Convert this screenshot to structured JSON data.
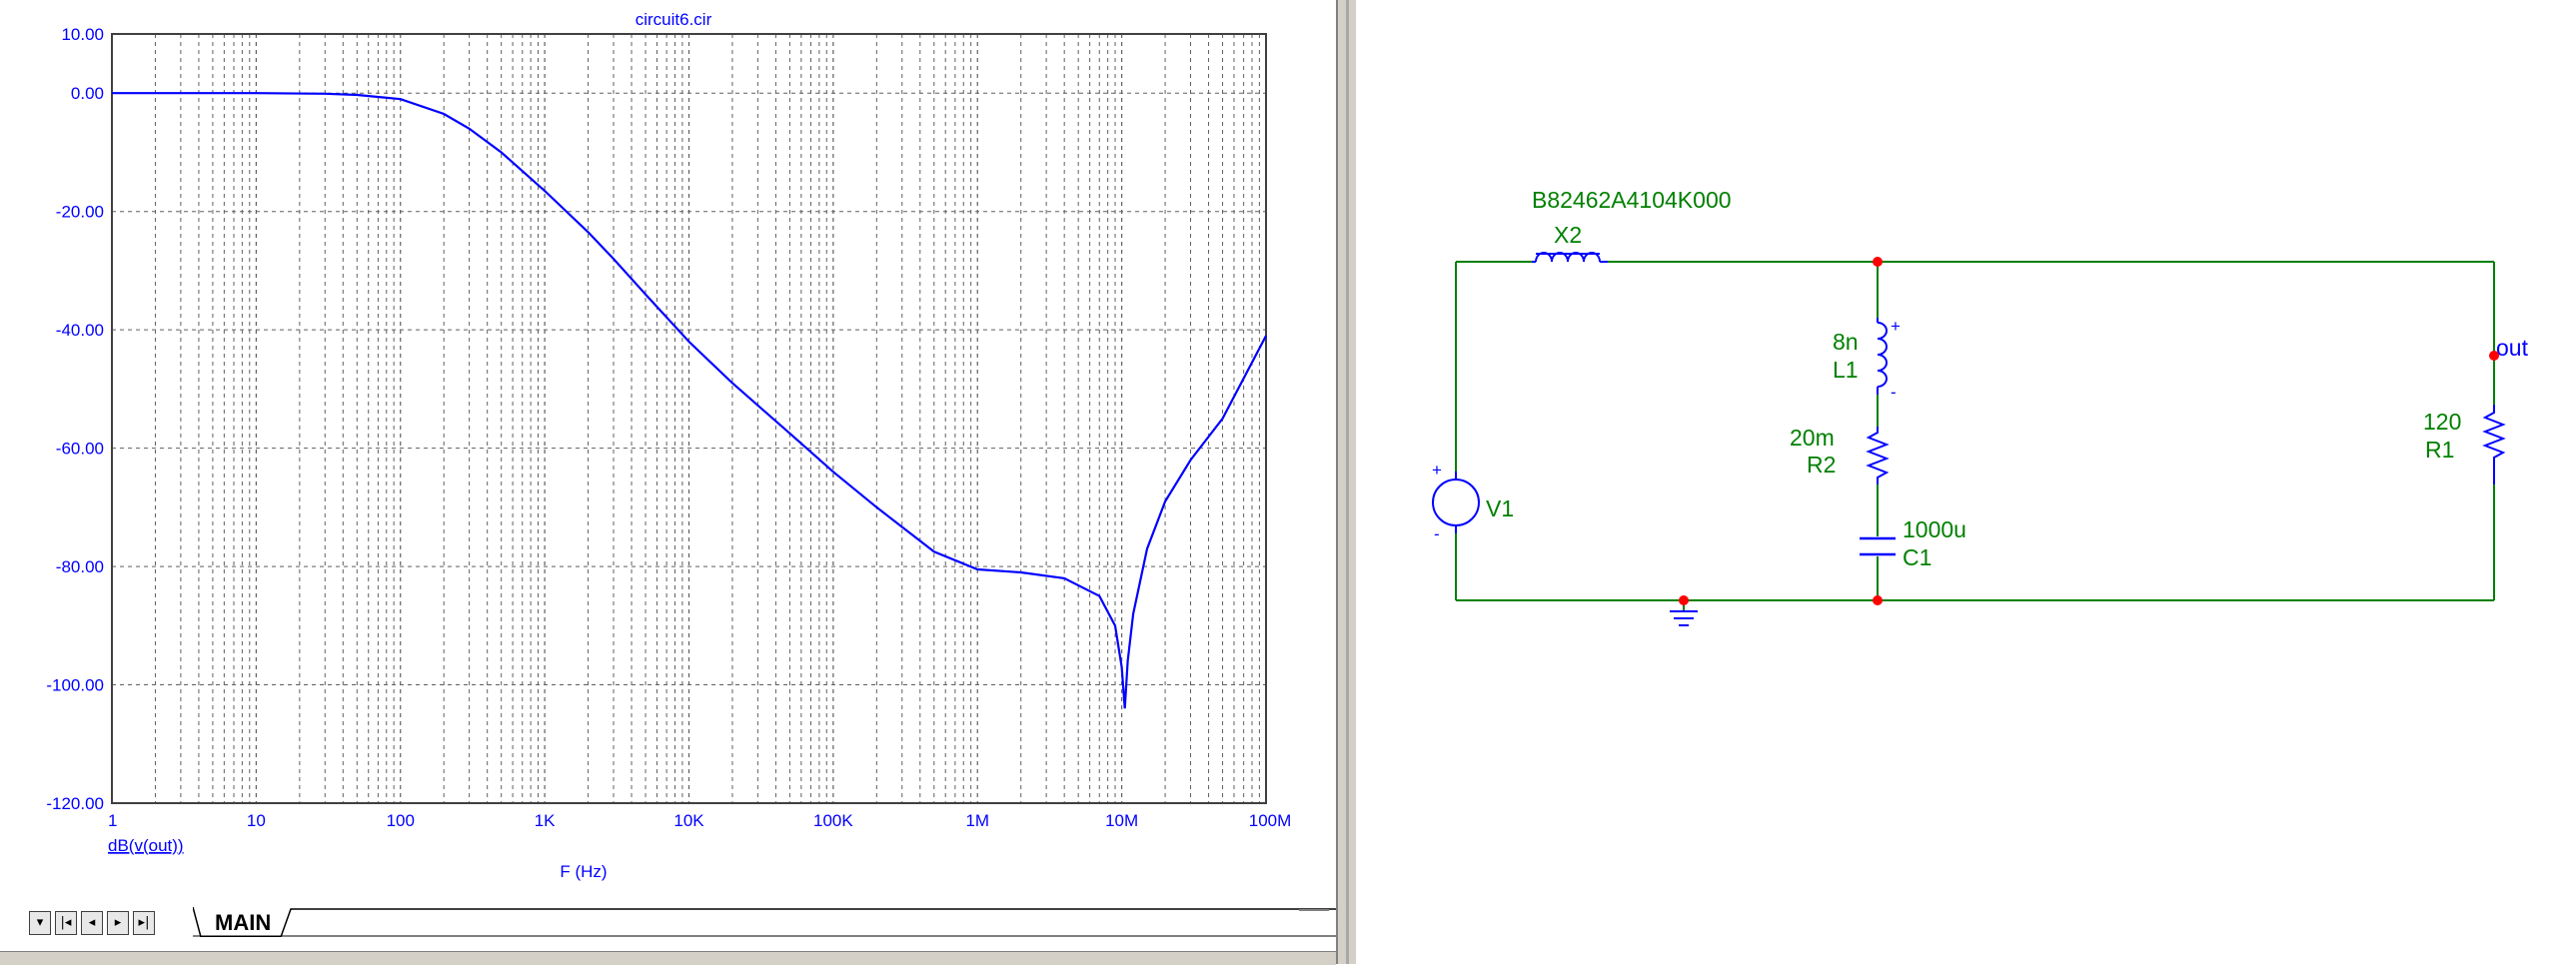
{
  "plot": {
    "title": "circuit6.cir",
    "y_trace_label": "dB(v(out))",
    "x_axis_label": "F (Hz)",
    "y_ticks": [
      "10.00",
      "0.00",
      "-20.00",
      "-40.00",
      "-60.00",
      "-80.00",
      "-100.00",
      "-120.00"
    ],
    "x_ticks": [
      "1",
      "10",
      "100",
      "1K",
      "10K",
      "100K",
      "1M",
      "10M",
      "100M"
    ],
    "line_color": "#0000ff"
  },
  "chart_data": {
    "type": "line",
    "title": "circuit6.cir",
    "xlabel": "F (Hz)",
    "ylabel": "dB(v(out))",
    "x_scale": "log",
    "xlim": [
      1,
      100000000
    ],
    "ylim": [
      -120,
      10
    ],
    "grid": true,
    "series": [
      {
        "name": "dB(v(out))",
        "x": [
          1,
          10,
          30,
          50,
          100,
          200,
          300,
          500,
          1000,
          2000,
          3000,
          5000,
          10000,
          20000,
          50000,
          100000,
          200000,
          500000,
          1000000,
          2000000,
          4000000,
          7000000,
          9000000,
          10000000,
          10500000,
          11000000,
          12000000,
          15000000,
          20000000,
          30000000,
          50000000,
          100000000
        ],
        "y": [
          0,
          0,
          -0.1,
          -0.3,
          -1,
          -3.5,
          -6,
          -10,
          -16.5,
          -23.5,
          -28,
          -34,
          -42,
          -49,
          -57.5,
          -64,
          -70,
          -77.5,
          -80.5,
          -81,
          -82,
          -85,
          -90,
          -97,
          -104,
          -96,
          -88,
          -77,
          -69,
          -62,
          -55,
          -41
        ]
      }
    ]
  },
  "schematic": {
    "x2_part": "B82462A4104K000",
    "x2_name": "X2",
    "l1_value": "8n",
    "l1_name": "L1",
    "r2_value": "20m",
    "r2_name": "R2",
    "c1_value": "1000u",
    "c1_name": "C1",
    "r1_value": "120",
    "r1_name": "R1",
    "v1_name": "V1",
    "out_label": "out",
    "plus": "+",
    "minus": "-",
    "wire_color": "#008000",
    "component_color": "#0000ff",
    "node_color": "#ff0000"
  },
  "tabs": {
    "active": "MAIN",
    "nav": [
      "▾",
      "|◂",
      "◂",
      "▸",
      "▸|"
    ]
  }
}
